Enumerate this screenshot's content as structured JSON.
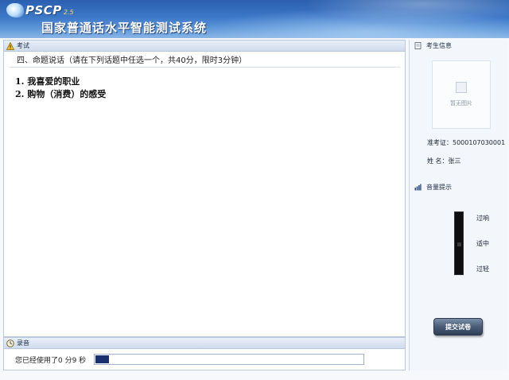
{
  "header": {
    "logo_text": "PSCP",
    "logo_sub": "2.5",
    "title": "国家普通话水平智能测试系统"
  },
  "exam": {
    "section_label": "考试",
    "question_head": "四、命题说话（请在下列话题中任选一个，共40分，限时3分钟）",
    "topics": [
      "1. 我喜爱的职业",
      "2. 购物（消费）的感受"
    ]
  },
  "recording": {
    "section_label": "录音",
    "elapsed_text": "您已经使用了0 分9 秒",
    "progress": 0.05
  },
  "sidebar": {
    "candidate_label": "考生信息",
    "photo_label": "暂无图片",
    "ticket": "准考证：5000107030001",
    "name": "姓    名：张三",
    "volume_label": "音量提示",
    "vol_high": "过响",
    "vol_mid": "适中",
    "vol_low": "过轻",
    "submit_label": "提交试卷"
  },
  "colors": {
    "banner": "#3d78c8",
    "progress_fill": "#1a2f6e"
  }
}
